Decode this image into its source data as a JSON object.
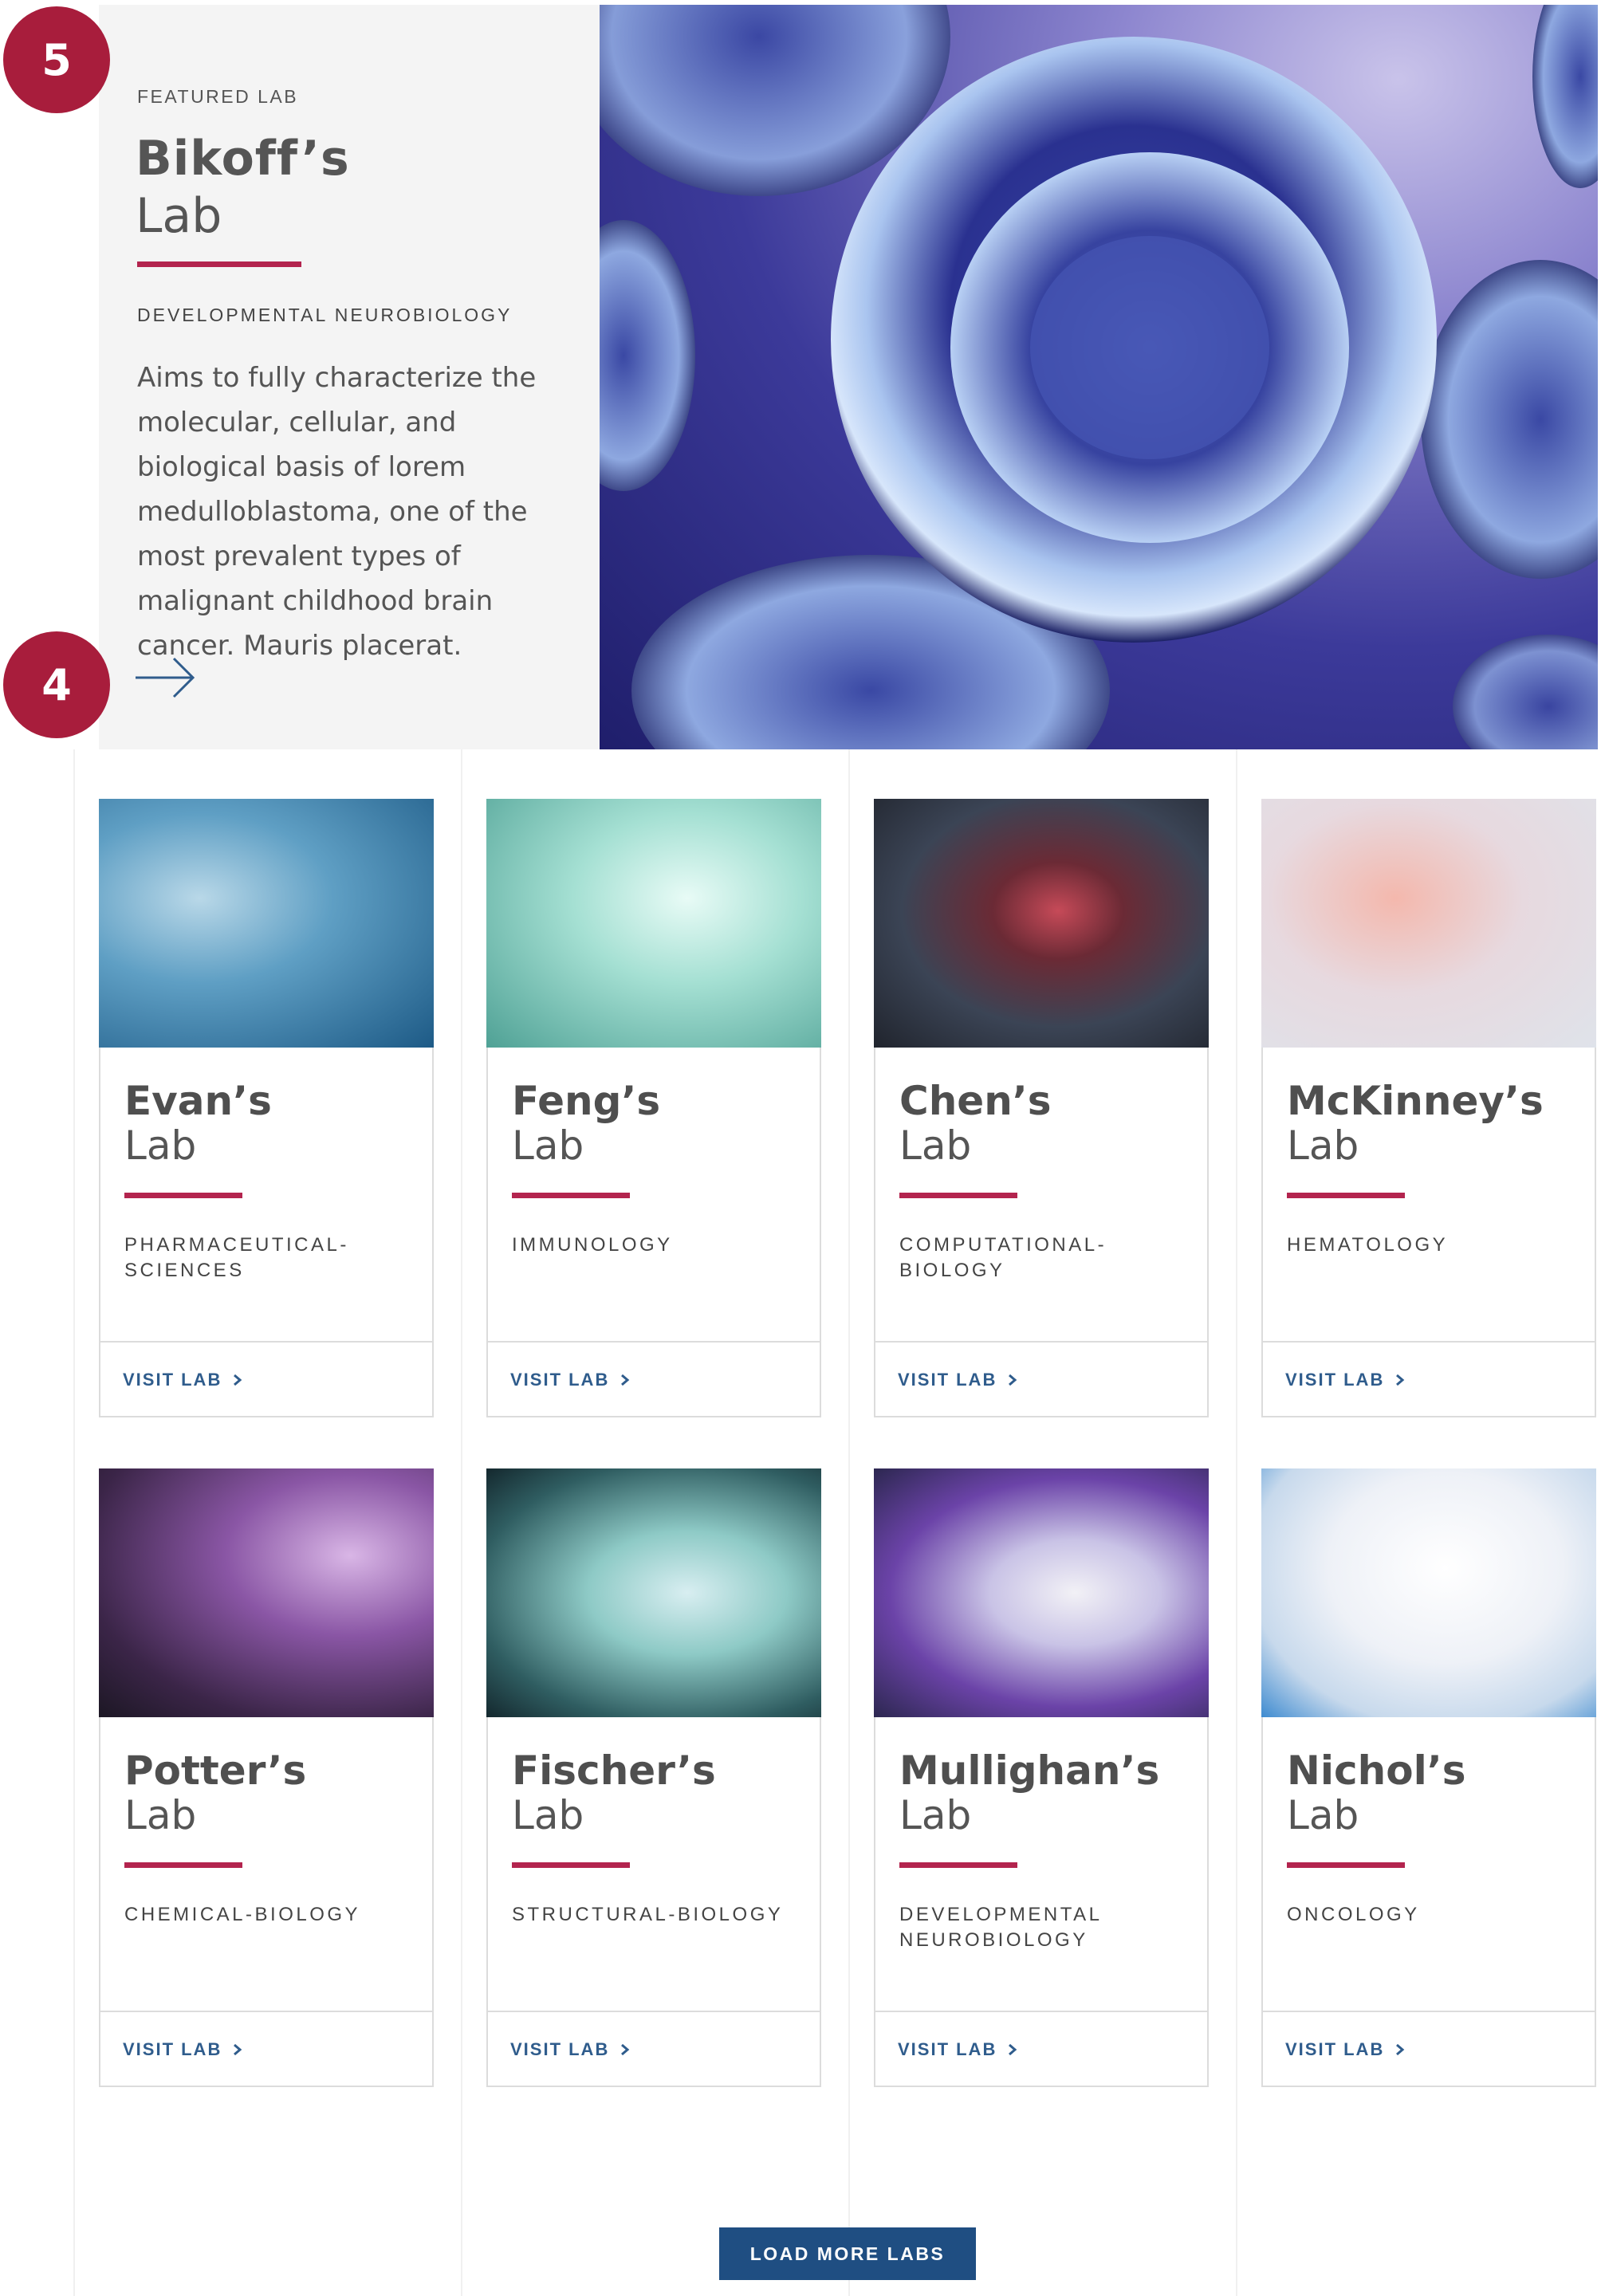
{
  "featured": {
    "eyebrow": "FEATURED LAB",
    "title_line1": "Bikoff’s",
    "title_line2": "Lab",
    "category": "DEVELOPMENTAL NEUROBIOLOGY",
    "description": "Aims to fully characterize the molecular, cellular, and biological basis of lorem medulloblastoma, one of the most prevalent types of malignant childhood brain cancer. Mauris placerat.",
    "arrow_icon": "arrow-right-icon"
  },
  "annotations": {
    "badge_top": "5",
    "badge_bottom": "4"
  },
  "labs": [
    {
      "name": "Evan’s",
      "lab": "Lab",
      "category": "PHARMACEUTICAL-\nSCIENCES",
      "cta": "VISIT LAB"
    },
    {
      "name": "Feng’s",
      "lab": "Lab",
      "category": "IMMUNOLOGY",
      "cta": "VISIT LAB"
    },
    {
      "name": "Chen’s",
      "lab": "Lab",
      "category": "COMPUTATIONAL-\nBIOLOGY",
      "cta": "VISIT LAB"
    },
    {
      "name": "McKinney’s",
      "lab": "Lab",
      "category": "HEMATOLOGY",
      "cta": "VISIT LAB"
    },
    {
      "name": "Potter’s",
      "lab": "Lab",
      "category": "CHEMICAL-BIOLOGY",
      "cta": "VISIT LAB"
    },
    {
      "name": "Fischer’s",
      "lab": "Lab",
      "category": "STRUCTURAL-BIOLOGY",
      "cta": "VISIT LAB"
    },
    {
      "name": "Mullighan’s",
      "lab": "Lab",
      "category": "DEVELOPMENTAL\nNEUROBIOLOGY",
      "cta": "VISIT LAB"
    },
    {
      "name": "Nichol’s",
      "lab": "Lab",
      "category": "ONCOLOGY",
      "cta": "VISIT LAB"
    }
  ],
  "load_more": "LOAD MORE LABS",
  "colors": {
    "accent": "#b3244e",
    "link": "#2f5c8c",
    "button": "#1f4e82",
    "badge": "#a81d3c"
  }
}
